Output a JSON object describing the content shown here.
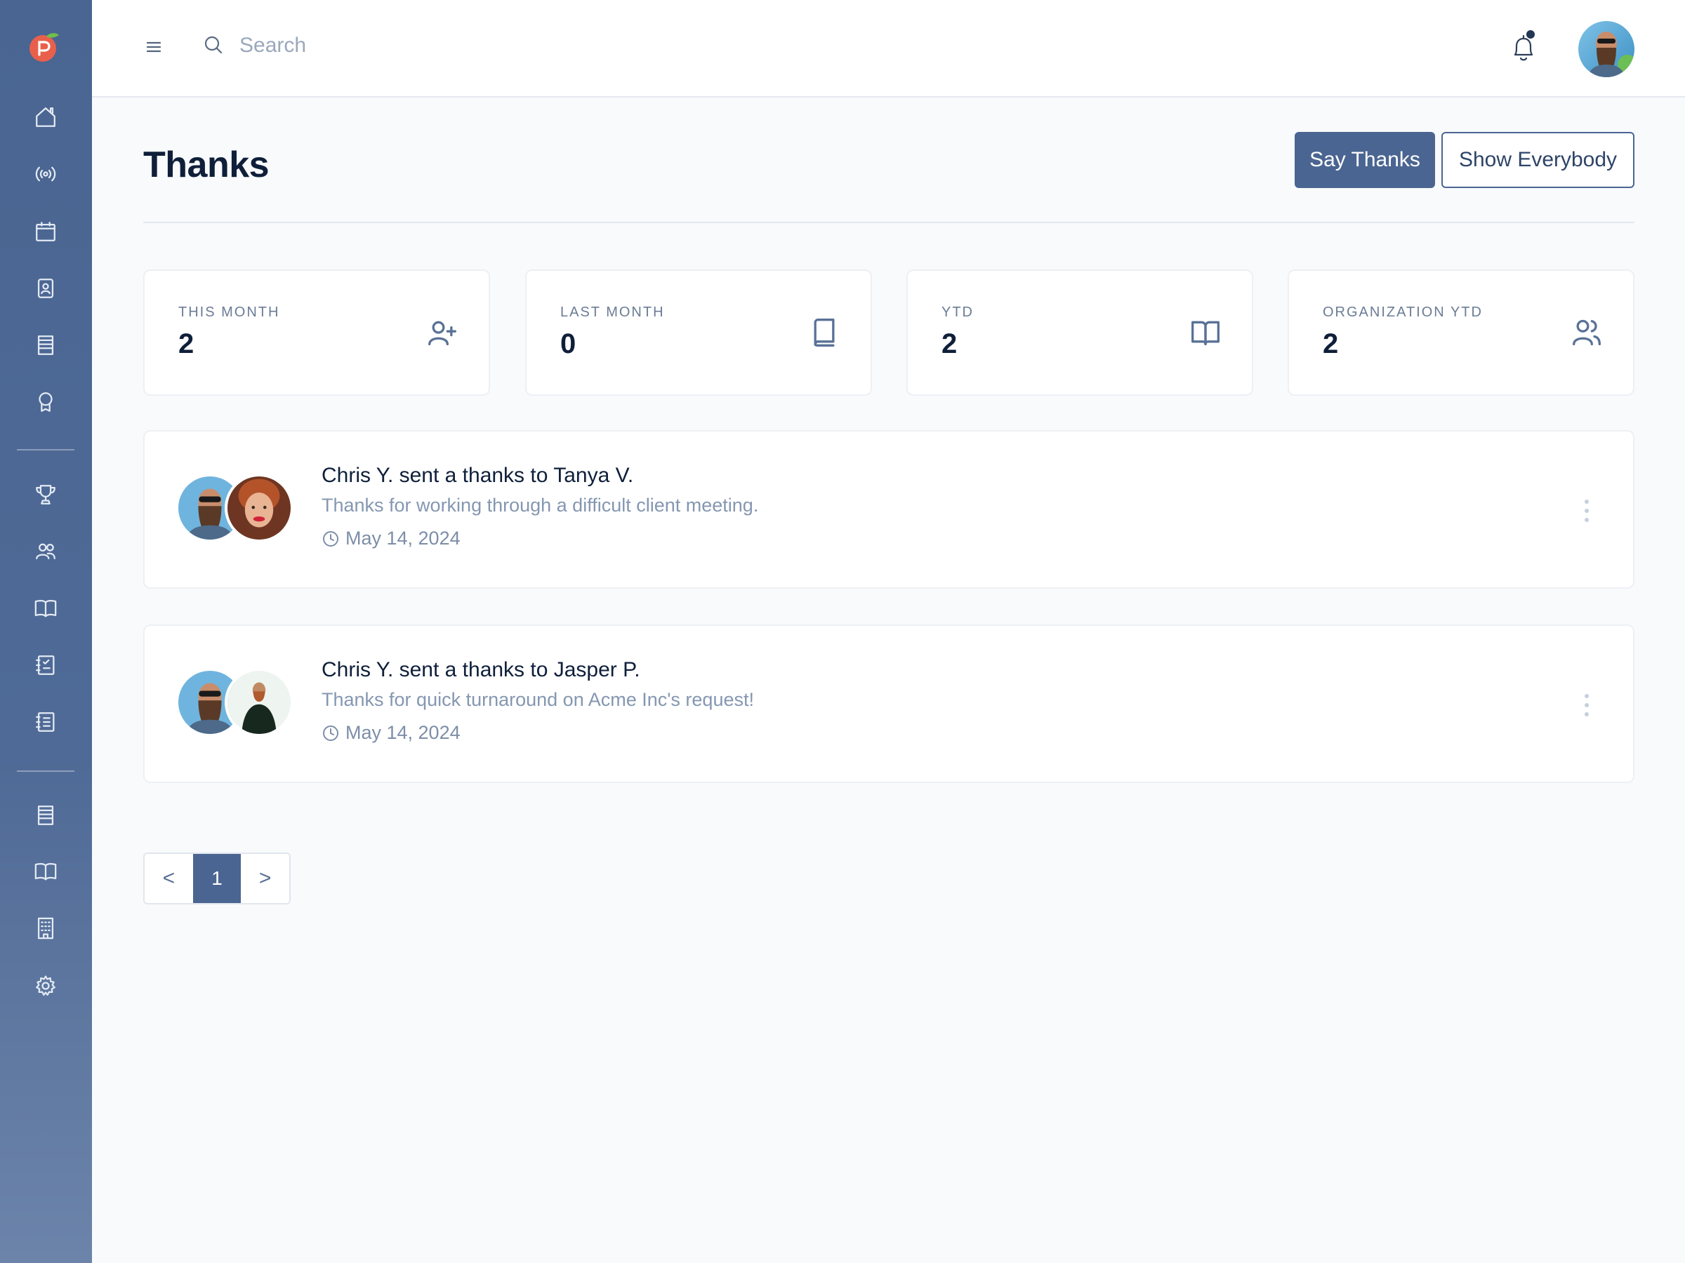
{
  "topbar": {
    "search_placeholder": "Search",
    "menu_icon": "hamburger-menu-icon",
    "search_icon": "search-icon",
    "bell_icon": "bell-icon"
  },
  "sidebar": {
    "logo": "app-logo",
    "group1": [
      "home-icon",
      "broadcast-icon",
      "calendar-icon",
      "contact-card-icon",
      "ladder-icon",
      "award-icon"
    ],
    "group2": [
      "trophy-icon",
      "users-icon",
      "book-open-icon",
      "checklist-icon",
      "document-list-icon"
    ],
    "group3": [
      "ladder-icon",
      "book-open-icon",
      "building-icon",
      "gear-icon"
    ]
  },
  "header": {
    "title": "Thanks",
    "say_thanks_label": "Say Thanks",
    "show_everybody_label": "Show Everybody"
  },
  "stats": [
    {
      "label": "THIS MONTH",
      "value": "2",
      "icon": "user-plus-icon"
    },
    {
      "label": "LAST MONTH",
      "value": "0",
      "icon": "book-icon"
    },
    {
      "label": "YTD",
      "value": "2",
      "icon": "book-open-icon"
    },
    {
      "label": "ORGANIZATION YTD",
      "value": "2",
      "icon": "users-icon"
    }
  ],
  "thanks": [
    {
      "title": "Chris Y. sent a thanks to Tanya V.",
      "message": "Thanks for working through a difficult client meeting.",
      "date": "May 14, 2024"
    },
    {
      "title": "Chris Y. sent a thanks to Jasper P.",
      "message": "Thanks for quick turnaround on Acme Inc's request!",
      "date": "May 14, 2024"
    }
  ],
  "pagination": {
    "prev": "<",
    "current": "1",
    "next": ">"
  },
  "colors": {
    "primary": "#4a6591",
    "background": "#f8fafc",
    "text": "#0f1f3a",
    "muted": "#8597b1"
  }
}
